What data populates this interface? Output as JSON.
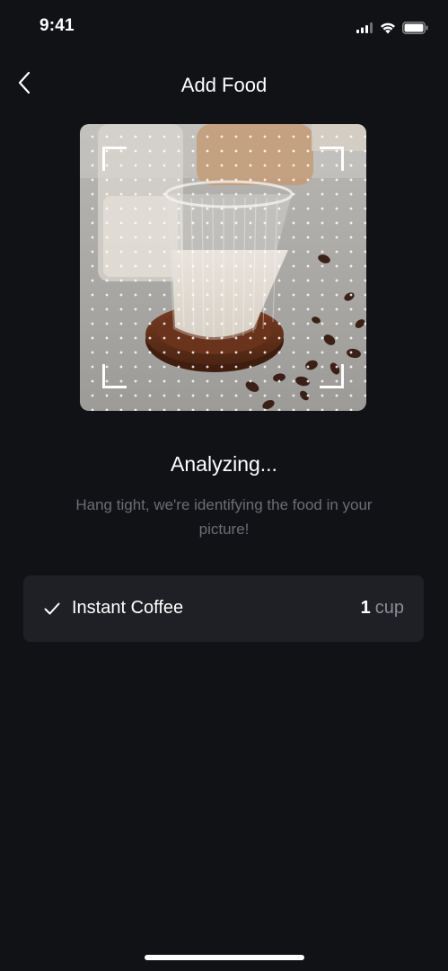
{
  "status_bar": {
    "time": "9:41",
    "icons": [
      "signal-icon",
      "wifi-icon",
      "battery-icon"
    ]
  },
  "header": {
    "title": "Add Food",
    "back_icon": "chevron-left-icon"
  },
  "scan": {
    "image": "photo of a glass of milky coffee on a wooden coaster with coffee beans",
    "frame_icon": "scan-frame-corners"
  },
  "status": {
    "title": "Analyzing...",
    "subtitle": "Hang tight, we're identifying the food in your picture!"
  },
  "results": [
    {
      "name": "Instant Coffee",
      "quantity": "1",
      "unit": "cup",
      "icon": "check-icon"
    }
  ],
  "colors": {
    "background": "#111216",
    "card": "#1f2025",
    "muted_text": "#6b6d74",
    "unit_text": "#8b8d93"
  }
}
